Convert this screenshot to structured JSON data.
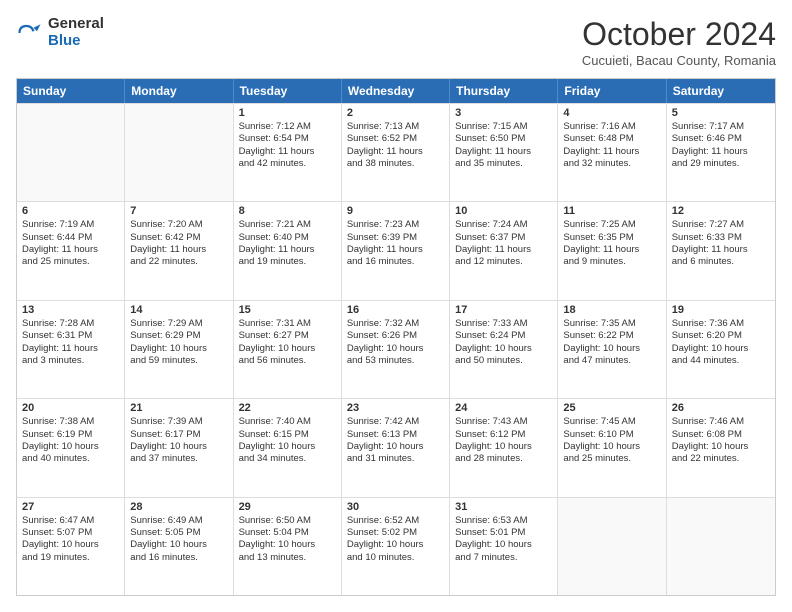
{
  "logo": {
    "general": "General",
    "blue": "Blue"
  },
  "header": {
    "month": "October 2024",
    "location": "Cucuieti, Bacau County, Romania"
  },
  "days": [
    "Sunday",
    "Monday",
    "Tuesday",
    "Wednesday",
    "Thursday",
    "Friday",
    "Saturday"
  ],
  "weeks": [
    [
      {
        "day": "",
        "empty": true
      },
      {
        "day": "",
        "empty": true
      },
      {
        "num": "1",
        "line1": "Sunrise: 7:12 AM",
        "line2": "Sunset: 6:54 PM",
        "line3": "Daylight: 11 hours",
        "line4": "and 42 minutes."
      },
      {
        "num": "2",
        "line1": "Sunrise: 7:13 AM",
        "line2": "Sunset: 6:52 PM",
        "line3": "Daylight: 11 hours",
        "line4": "and 38 minutes."
      },
      {
        "num": "3",
        "line1": "Sunrise: 7:15 AM",
        "line2": "Sunset: 6:50 PM",
        "line3": "Daylight: 11 hours",
        "line4": "and 35 minutes."
      },
      {
        "num": "4",
        "line1": "Sunrise: 7:16 AM",
        "line2": "Sunset: 6:48 PM",
        "line3": "Daylight: 11 hours",
        "line4": "and 32 minutes."
      },
      {
        "num": "5",
        "line1": "Sunrise: 7:17 AM",
        "line2": "Sunset: 6:46 PM",
        "line3": "Daylight: 11 hours",
        "line4": "and 29 minutes."
      }
    ],
    [
      {
        "num": "6",
        "line1": "Sunrise: 7:19 AM",
        "line2": "Sunset: 6:44 PM",
        "line3": "Daylight: 11 hours",
        "line4": "and 25 minutes."
      },
      {
        "num": "7",
        "line1": "Sunrise: 7:20 AM",
        "line2": "Sunset: 6:42 PM",
        "line3": "Daylight: 11 hours",
        "line4": "and 22 minutes."
      },
      {
        "num": "8",
        "line1": "Sunrise: 7:21 AM",
        "line2": "Sunset: 6:40 PM",
        "line3": "Daylight: 11 hours",
        "line4": "and 19 minutes."
      },
      {
        "num": "9",
        "line1": "Sunrise: 7:23 AM",
        "line2": "Sunset: 6:39 PM",
        "line3": "Daylight: 11 hours",
        "line4": "and 16 minutes."
      },
      {
        "num": "10",
        "line1": "Sunrise: 7:24 AM",
        "line2": "Sunset: 6:37 PM",
        "line3": "Daylight: 11 hours",
        "line4": "and 12 minutes."
      },
      {
        "num": "11",
        "line1": "Sunrise: 7:25 AM",
        "line2": "Sunset: 6:35 PM",
        "line3": "Daylight: 11 hours",
        "line4": "and 9 minutes."
      },
      {
        "num": "12",
        "line1": "Sunrise: 7:27 AM",
        "line2": "Sunset: 6:33 PM",
        "line3": "Daylight: 11 hours",
        "line4": "and 6 minutes."
      }
    ],
    [
      {
        "num": "13",
        "line1": "Sunrise: 7:28 AM",
        "line2": "Sunset: 6:31 PM",
        "line3": "Daylight: 11 hours",
        "line4": "and 3 minutes."
      },
      {
        "num": "14",
        "line1": "Sunrise: 7:29 AM",
        "line2": "Sunset: 6:29 PM",
        "line3": "Daylight: 10 hours",
        "line4": "and 59 minutes."
      },
      {
        "num": "15",
        "line1": "Sunrise: 7:31 AM",
        "line2": "Sunset: 6:27 PM",
        "line3": "Daylight: 10 hours",
        "line4": "and 56 minutes."
      },
      {
        "num": "16",
        "line1": "Sunrise: 7:32 AM",
        "line2": "Sunset: 6:26 PM",
        "line3": "Daylight: 10 hours",
        "line4": "and 53 minutes."
      },
      {
        "num": "17",
        "line1": "Sunrise: 7:33 AM",
        "line2": "Sunset: 6:24 PM",
        "line3": "Daylight: 10 hours",
        "line4": "and 50 minutes."
      },
      {
        "num": "18",
        "line1": "Sunrise: 7:35 AM",
        "line2": "Sunset: 6:22 PM",
        "line3": "Daylight: 10 hours",
        "line4": "and 47 minutes."
      },
      {
        "num": "19",
        "line1": "Sunrise: 7:36 AM",
        "line2": "Sunset: 6:20 PM",
        "line3": "Daylight: 10 hours",
        "line4": "and 44 minutes."
      }
    ],
    [
      {
        "num": "20",
        "line1": "Sunrise: 7:38 AM",
        "line2": "Sunset: 6:19 PM",
        "line3": "Daylight: 10 hours",
        "line4": "and 40 minutes."
      },
      {
        "num": "21",
        "line1": "Sunrise: 7:39 AM",
        "line2": "Sunset: 6:17 PM",
        "line3": "Daylight: 10 hours",
        "line4": "and 37 minutes."
      },
      {
        "num": "22",
        "line1": "Sunrise: 7:40 AM",
        "line2": "Sunset: 6:15 PM",
        "line3": "Daylight: 10 hours",
        "line4": "and 34 minutes."
      },
      {
        "num": "23",
        "line1": "Sunrise: 7:42 AM",
        "line2": "Sunset: 6:13 PM",
        "line3": "Daylight: 10 hours",
        "line4": "and 31 minutes."
      },
      {
        "num": "24",
        "line1": "Sunrise: 7:43 AM",
        "line2": "Sunset: 6:12 PM",
        "line3": "Daylight: 10 hours",
        "line4": "and 28 minutes."
      },
      {
        "num": "25",
        "line1": "Sunrise: 7:45 AM",
        "line2": "Sunset: 6:10 PM",
        "line3": "Daylight: 10 hours",
        "line4": "and 25 minutes."
      },
      {
        "num": "26",
        "line1": "Sunrise: 7:46 AM",
        "line2": "Sunset: 6:08 PM",
        "line3": "Daylight: 10 hours",
        "line4": "and 22 minutes."
      }
    ],
    [
      {
        "num": "27",
        "line1": "Sunrise: 6:47 AM",
        "line2": "Sunset: 5:07 PM",
        "line3": "Daylight: 10 hours",
        "line4": "and 19 minutes."
      },
      {
        "num": "28",
        "line1": "Sunrise: 6:49 AM",
        "line2": "Sunset: 5:05 PM",
        "line3": "Daylight: 10 hours",
        "line4": "and 16 minutes."
      },
      {
        "num": "29",
        "line1": "Sunrise: 6:50 AM",
        "line2": "Sunset: 5:04 PM",
        "line3": "Daylight: 10 hours",
        "line4": "and 13 minutes."
      },
      {
        "num": "30",
        "line1": "Sunrise: 6:52 AM",
        "line2": "Sunset: 5:02 PM",
        "line3": "Daylight: 10 hours",
        "line4": "and 10 minutes."
      },
      {
        "num": "31",
        "line1": "Sunrise: 6:53 AM",
        "line2": "Sunset: 5:01 PM",
        "line3": "Daylight: 10 hours",
        "line4": "and 7 minutes."
      },
      {
        "day": "",
        "empty": true
      },
      {
        "day": "",
        "empty": true
      }
    ]
  ]
}
